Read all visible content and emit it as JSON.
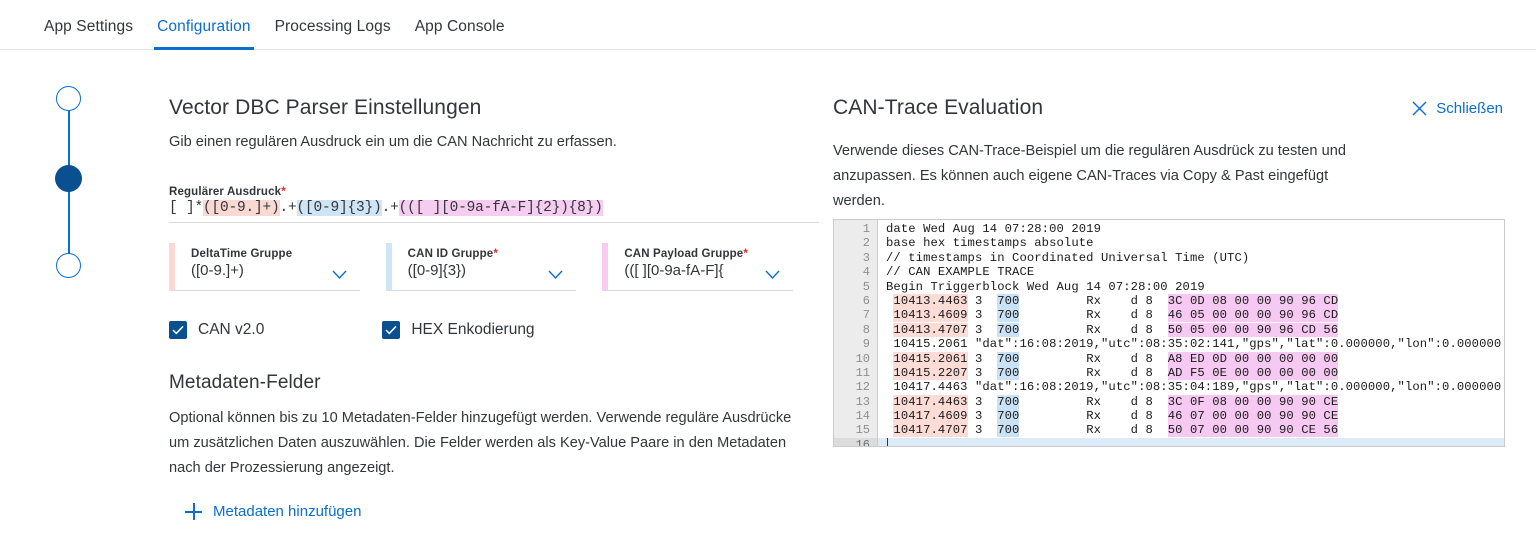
{
  "tabs": [
    {
      "label": "App Settings",
      "active": false
    },
    {
      "label": "Configuration",
      "active": true
    },
    {
      "label": "Processing Logs",
      "active": false
    },
    {
      "label": "App Console",
      "active": false
    }
  ],
  "left_panel": {
    "title": "Vector DBC Parser Einstellungen",
    "subtitle": "Gib einen regulären Ausdruck ein um die CAN Nachricht zu erfassen.",
    "regex_field": {
      "label": "Regulärer Ausdruck",
      "required_marker": "*",
      "value": "[ ]*([0-9.]+).+([0-9]{3}).+(([ ][0-9a-fA-F]{2}){8})",
      "segments": {
        "pre": "[ ]*",
        "group1": "([0-9.]+)",
        "sep1": ".+",
        "group2": "([0-9]{3})",
        "sep2": ".+",
        "group3": "(([ ][0-9a-fA-F]{2}){8})"
      }
    },
    "dropdowns": [
      {
        "label": "DeltaTime Gruppe",
        "required_marker": "",
        "value": "([0-9.]+)",
        "color": "#fbd9d3"
      },
      {
        "label": "CAN ID Gruppe",
        "required_marker": "*",
        "value": "([0-9]{3})",
        "color": "#cfe5f5"
      },
      {
        "label": "CAN Payload Gruppe",
        "required_marker": "*",
        "value": "(([ ][0-9a-fA-F]{",
        "color": "#f6cdf0"
      }
    ],
    "checkboxes": [
      {
        "label": "CAN v2.0",
        "checked": true
      },
      {
        "label": "HEX Enkodierung",
        "checked": true
      }
    ],
    "metadata": {
      "title": "Metadaten-Felder",
      "description": "Optional können bis zu 10 Metadaten-Felder hinzugefügt werden. Verwende reguläre Ausdrücke um zusätzlichen Daten auszuwählen. Die Felder werden als Key-Value Paare in den Metadaten nach der Prozessierung angezeigt.",
      "add_link": "Metadaten hinzufügen"
    }
  },
  "right_panel": {
    "title": "CAN-Trace Evaluation",
    "close_label": "Schließen",
    "description": "Verwende dieses CAN-Trace-Beispiel um die regulären Ausdrück zu testen und anzupassen. Es können auch eigene CAN-Traces via Copy & Past eingefügt werden.",
    "editor": {
      "current_line": 16,
      "lines": [
        {
          "n": 1,
          "plain": "date Wed Aug 14 07:28:00 2019"
        },
        {
          "n": 2,
          "plain": "base hex timestamps absolute"
        },
        {
          "n": 3,
          "plain": "// timestamps in Coordinated Universal Time (UTC)"
        },
        {
          "n": 4,
          "plain": "// CAN EXAMPLE TRACE"
        },
        {
          "n": 5,
          "plain": "Begin Triggerblock Wed Aug 14 07:28:00 2019"
        },
        {
          "n": 6,
          "ts": "10413.4463",
          "mid1": " 3  ",
          "id": "700",
          "mid2": "         Rx    d 8  ",
          "payload": "3C 0D 08 00 00 90 96 CD"
        },
        {
          "n": 7,
          "ts": "10413.4609",
          "mid1": " 3  ",
          "id": "700",
          "mid2": "         Rx    d 8  ",
          "payload": "46 05 00 00 00 90 96 CD"
        },
        {
          "n": 8,
          "ts": "10413.4707",
          "mid1": " 3  ",
          "id": "700",
          "mid2": "         Rx    d 8  ",
          "payload": "50 05 00 00 90 96 CD 56"
        },
        {
          "n": 9,
          "plain": " 10415.2061 \"dat\":16:08:2019,\"utc\":08:35:02:141,\"gps\",\"lat\":0.000000,\"lon\":0.000000"
        },
        {
          "n": 10,
          "ts": "10415.2061",
          "mid1": " 3  ",
          "id": "700",
          "mid2": "         Rx    d 8  ",
          "payload": "A8 ED 0D 00 00 00 00 00"
        },
        {
          "n": 11,
          "ts": "10415.2207",
          "mid1": " 3  ",
          "id": "700",
          "mid2": "         Rx    d 8  ",
          "payload": "AD F5 0E 00 00 00 00 00"
        },
        {
          "n": 12,
          "plain": " 10417.4463 \"dat\":16:08:2019,\"utc\":08:35:04:189,\"gps\",\"lat\":0.000000,\"lon\":0.000000"
        },
        {
          "n": 13,
          "ts": "10417.4463",
          "mid1": " 3  ",
          "id": "700",
          "mid2": "         Rx    d 8  ",
          "payload": "3C 0F 08 00 00 90 90 CE"
        },
        {
          "n": 14,
          "ts": "10417.4609",
          "mid1": " 3  ",
          "id": "700",
          "mid2": "         Rx    d 8  ",
          "payload": "46 07 00 00 00 90 90 CE"
        },
        {
          "n": 15,
          "ts": "10417.4707",
          "mid1": " 3  ",
          "id": "700",
          "mid2": "         Rx    d 8  ",
          "payload": "50 07 00 00 90 90 CE 56"
        },
        {
          "n": 16,
          "plain": ""
        }
      ]
    }
  },
  "colors": {
    "accent": "#0a6ed1",
    "accent_dark": "#0a5091",
    "required": "#e4252a",
    "group1": "#fbd9d3",
    "group2": "#cfe5f5",
    "group3": "#f6cdf0",
    "text": "#32363a"
  }
}
